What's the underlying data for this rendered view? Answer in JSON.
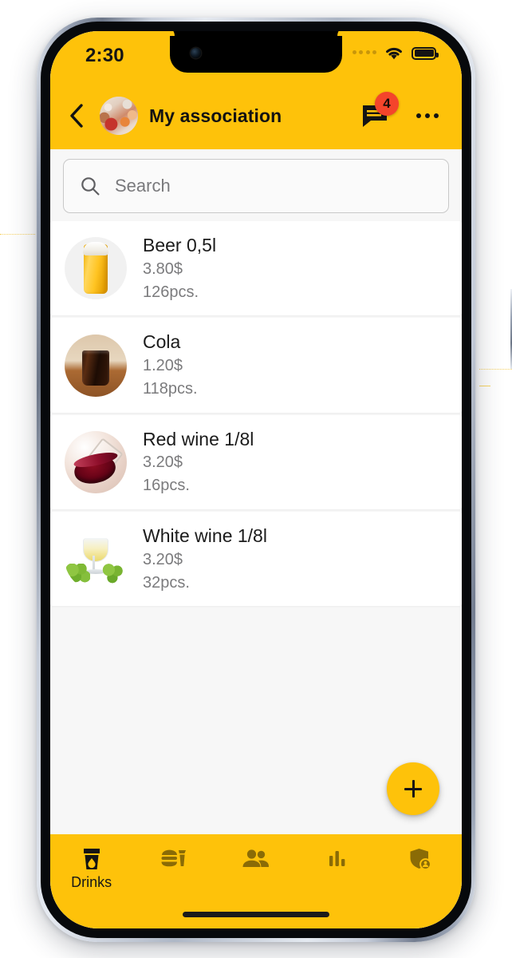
{
  "status_bar": {
    "time": "2:30",
    "signal_icon": "signal-dots-icon",
    "wifi_icon": "wifi-icon",
    "battery_icon": "battery-full-icon"
  },
  "app_bar": {
    "back_icon": "back-chevron-icon",
    "avatar_icon": "group-avatar-image",
    "title": "My association",
    "chat_icon": "chat-bubble-icon",
    "chat_badge": "4",
    "more_icon": "more-horizontal-icon",
    "background_color": "#FEC20A",
    "badge_color": "#F4452B"
  },
  "search": {
    "placeholder": "Search",
    "value": "",
    "icon": "search-icon"
  },
  "drinks": [
    {
      "name": "Beer 0,5l",
      "price": "3.80$",
      "stock": "126pcs.",
      "thumb": "beer-glass-image"
    },
    {
      "name": "Cola",
      "price": "1.20$",
      "stock": "118pcs.",
      "thumb": "cola-glass-image"
    },
    {
      "name": "Red wine 1/8l",
      "price": "3.20$",
      "stock": "16pcs.",
      "thumb": "red-wine-glass-image"
    },
    {
      "name": "White wine 1/8l",
      "price": "3.20$",
      "stock": "32pcs.",
      "thumb": "white-wine-glass-image"
    }
  ],
  "fab": {
    "label": "+",
    "icon": "plus-icon"
  },
  "bottom_nav": {
    "items": [
      {
        "label": "Drinks",
        "icon": "drink-cup-icon",
        "active": true
      },
      {
        "label": "",
        "icon": "fast-food-icon",
        "active": false
      },
      {
        "label": "",
        "icon": "people-icon",
        "active": false
      },
      {
        "label": "",
        "icon": "bar-chart-icon",
        "active": false
      },
      {
        "label": "",
        "icon": "shield-user-icon",
        "active": false
      }
    ],
    "background_color": "#FEC20A",
    "active_color": "#141414",
    "inactive_color": "#8a6b06"
  }
}
